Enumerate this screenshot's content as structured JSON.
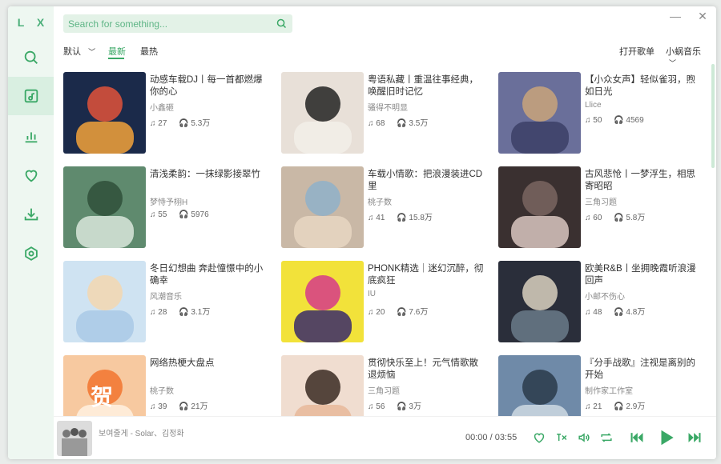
{
  "app": {
    "logo": "L X"
  },
  "search": {
    "placeholder": "Search for something..."
  },
  "toolbar": {
    "sort_default": "默认",
    "tab_latest": "最新",
    "tab_hot": "最热",
    "open_playlist": "打开歌单",
    "source": "小蜗音乐"
  },
  "window_controls": {
    "minimize": "—",
    "close": "✕"
  },
  "cards": [
    {
      "title": "动感车载DJ丨每一首都燃爆你的心",
      "author": "小鑫砸",
      "songs": "27",
      "plays": "5.3万"
    },
    {
      "title": "粤语私藏丨重温往事经典，唤醒旧时记忆",
      "author": "骚得不明显",
      "songs": "68",
      "plays": "3.5万"
    },
    {
      "title": "【小众女声】轻似雀羽，煦如日光",
      "author": "Llice",
      "songs": "50",
      "plays": "4569"
    },
    {
      "title": "清浅柔韵：一抹绿影接翠竹",
      "author": "梦恃予栩H",
      "songs": "55",
      "plays": "5976"
    },
    {
      "title": "车载小情歌：把浪漫装进CD里",
      "author": "桃子数",
      "songs": "41",
      "plays": "15.8万"
    },
    {
      "title": "古风悲怆丨一梦浮生，相思寄昭昭",
      "author": "三角习题",
      "songs": "60",
      "plays": "5.8万"
    },
    {
      "title": "冬日幻想曲 奔赴憧憬中的小确幸",
      "author": "风潮音乐",
      "songs": "28",
      "plays": "3.1万"
    },
    {
      "title": "PHONK精选｜迷幻沉醉，彻底疯狂",
      "author": "IU",
      "songs": "20",
      "plays": "7.6万"
    },
    {
      "title": "欧美R&B丨坐拥晚霞听浪漫回声",
      "author": "小邮不伤心",
      "songs": "48",
      "plays": "4.8万"
    },
    {
      "title": "网络热梗大盘点",
      "author": "桃子数",
      "songs": "39",
      "plays": "21万"
    },
    {
      "title": "贯彻快乐至上！元气情歌散退烦恼",
      "author": "三角习题",
      "songs": "56",
      "plays": "3万"
    },
    {
      "title": "『分手战歌』注视是离别的开始",
      "author": "制作家工作室",
      "songs": "21",
      "plays": "2.9万"
    }
  ],
  "cover_badge": "贺",
  "player": {
    "title": "보여줄게 - Solar、김정화",
    "time": "00:00 / 03:55"
  },
  "colors": {
    "accent": "#3aa866",
    "sidebar_bg": "#eef7f1",
    "search_bg": "#e3f2e7"
  }
}
